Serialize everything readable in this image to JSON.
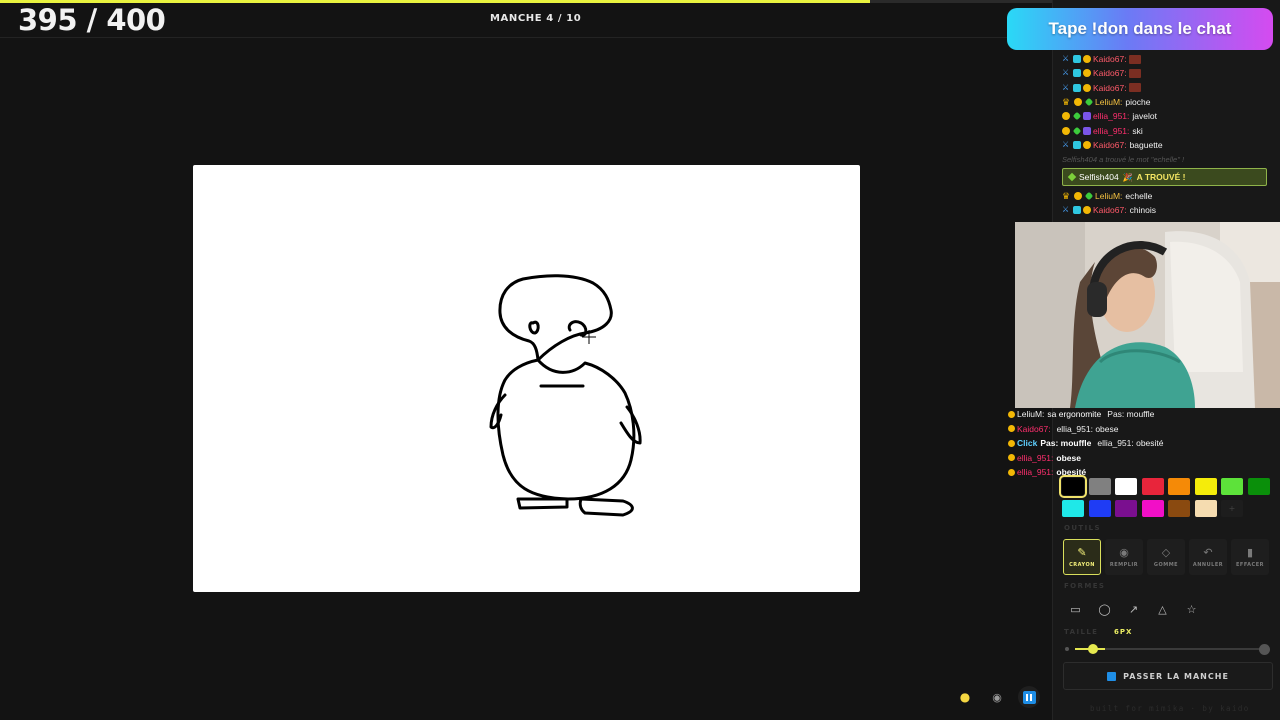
{
  "header": {
    "score": "395 / 400",
    "round": "MANCHE 4 / 10",
    "progress": 0.68
  },
  "banner": {
    "text": "Tape !don dans le chat"
  },
  "chat": {
    "messages": [
      {
        "user": "Kaido67:",
        "text": "",
        "color": "red"
      },
      {
        "user": "Kaido67:",
        "text": "",
        "color": "red"
      },
      {
        "user": "Kaido67:",
        "text": "",
        "color": "red"
      },
      {
        "user": "LeliuM:",
        "text": "pioche",
        "color": "orange"
      },
      {
        "user": "ellia_951:",
        "text": "javelot",
        "color": "pink"
      },
      {
        "user": "ellia_951:",
        "text": "ski",
        "color": "pink"
      },
      {
        "user": "Kaido67:",
        "text": "baguette",
        "color": "red"
      }
    ],
    "system_note": "Selfish404 a trouvé le mot \"echelle\" !",
    "found": {
      "name": "Selfish404",
      "text": "A TROUVÉ !"
    },
    "after": [
      {
        "user": "LeliuM:",
        "text": "echelle",
        "color": "orange"
      },
      {
        "user": "Kaido67:",
        "text": "chinois",
        "color": "red"
      }
    ]
  },
  "overlay_chat": [
    {
      "user": "LeliuM:",
      "text": "sa ergonomite",
      "extra": "Pas: mouffle"
    },
    {
      "user": "Kaido67:",
      "text": "",
      "extra": "ellia_951: obese"
    },
    {
      "user": "Click",
      "text": "Pas: mouffle",
      "extra": "ellia_951: obesité"
    },
    {
      "user": "ellia_951:",
      "text": "obese",
      "extra": ""
    },
    {
      "user": "ellia_951:",
      "text": "obesité",
      "extra": ""
    }
  ],
  "palette": {
    "colors": [
      "#000000",
      "#808080",
      "#ffffff",
      "#e8253b",
      "#f58a07",
      "#f5ec0a",
      "#5de23a",
      "#0a8f0a",
      "#1fe8e8",
      "#1f3cf5",
      "#7a0f8f",
      "#f20fc7",
      "#8a4a10",
      "#f5dcb0"
    ],
    "selected_index": 0
  },
  "labels": {
    "tools": "OUTILS",
    "shapes": "FORMES",
    "size": "TAILLE",
    "size_value": "6PX"
  },
  "tools": [
    {
      "label": "CRAYON",
      "icon": "pencil-icon",
      "glyph": "✎",
      "active": true
    },
    {
      "label": "REMPLIR",
      "icon": "bucket-icon",
      "glyph": "◉",
      "active": false
    },
    {
      "label": "GOMME",
      "icon": "eraser-icon",
      "glyph": "◇",
      "active": false
    },
    {
      "label": "ANNULER",
      "icon": "undo-icon",
      "glyph": "↶",
      "active": false
    },
    {
      "label": "EFFACER",
      "icon": "trash-icon",
      "glyph": "▮",
      "active": false
    }
  ],
  "shapes": [
    {
      "icon": "rectangle-icon",
      "glyph": "▭"
    },
    {
      "icon": "ellipse-icon",
      "glyph": "◯"
    },
    {
      "icon": "arrow-icon",
      "glyph": "↗"
    },
    {
      "icon": "triangle-icon",
      "glyph": "△"
    },
    {
      "icon": "star-icon",
      "glyph": "☆"
    }
  ],
  "brush_size": {
    "value": 6,
    "min": 1,
    "max": 60
  },
  "skip_button": "PASSER LA MANCHE",
  "footer": "built for mimika · by kaido"
}
